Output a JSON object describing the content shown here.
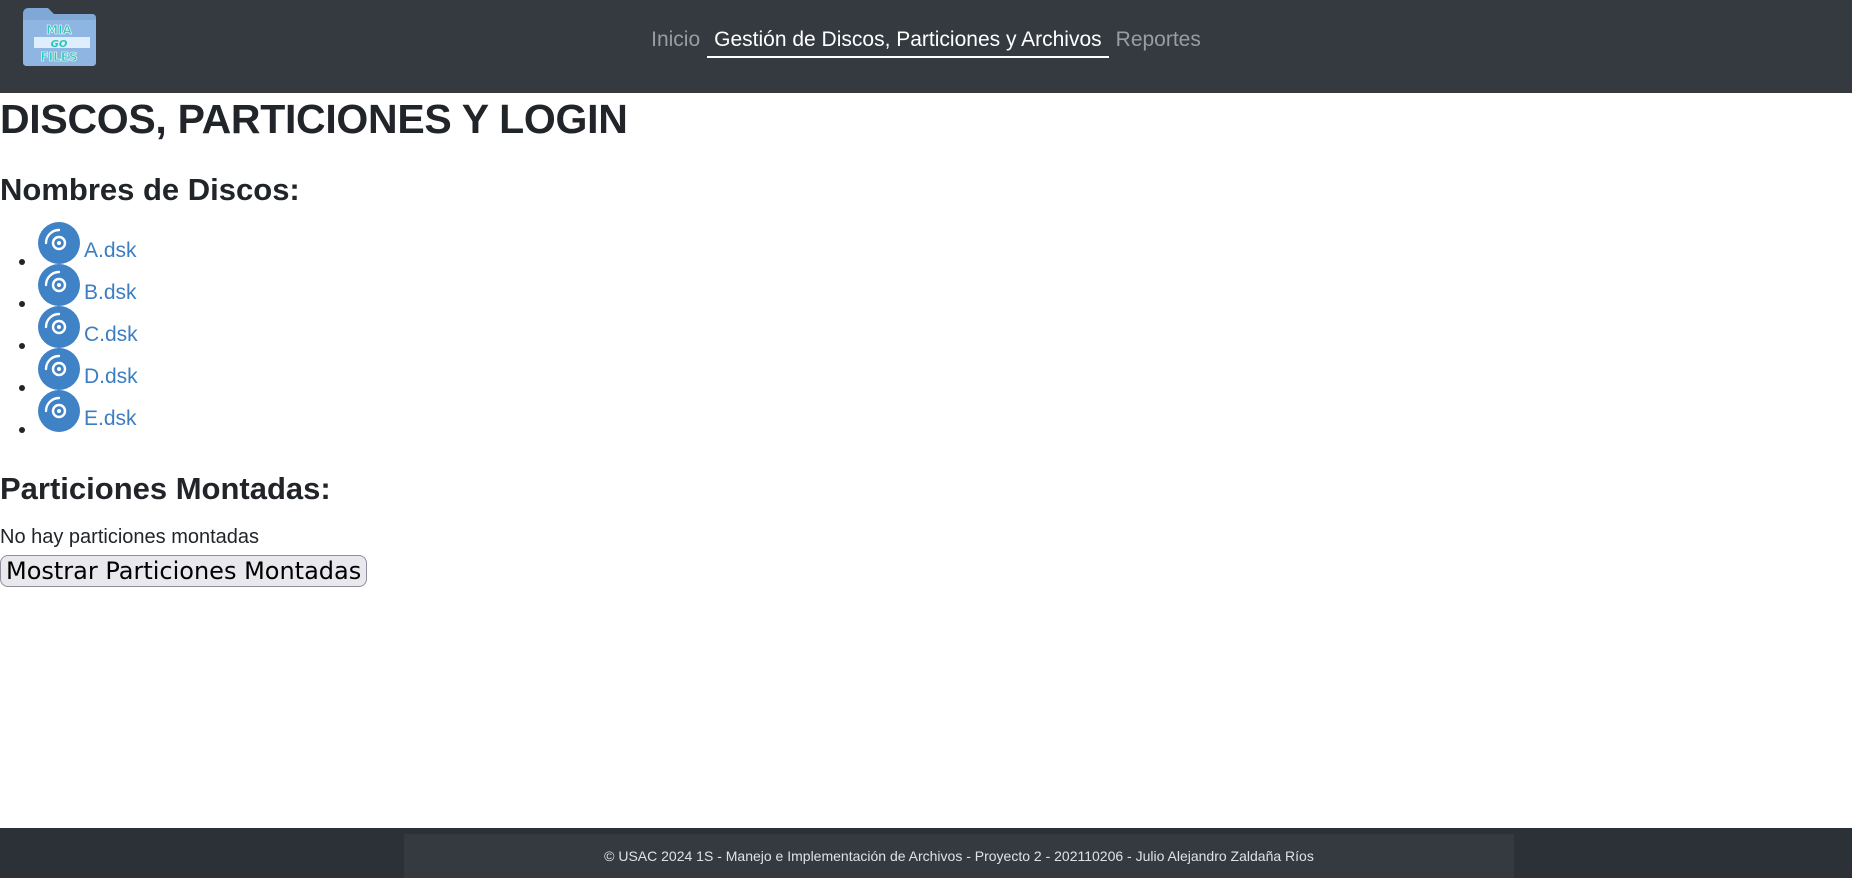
{
  "header": {
    "logo_text": "MIA GO FILES",
    "nav": [
      {
        "label": "Inicio"
      },
      {
        "label": "Gestión de Discos, Particiones y Archivos"
      },
      {
        "label": "Reportes"
      }
    ]
  },
  "main": {
    "title": "DISCOS, PARTICIONES Y LOGIN",
    "disks_heading": "Nombres de Discos:",
    "disks": [
      {
        "name": "A.dsk"
      },
      {
        "name": "B.dsk"
      },
      {
        "name": "C.dsk"
      },
      {
        "name": "D.dsk"
      },
      {
        "name": "E.dsk"
      }
    ],
    "partitions_heading": "Particiones Montadas:",
    "no_partitions_text": "No hay particiones montadas",
    "show_button_label": "Mostrar Particiones Montadas"
  },
  "footer": {
    "text": "© USAC 2024 1S - Manejo e Implementación de Archivos - Proyecto 2 - 202110206 - Julio Alejandro Zaldaña Ríos"
  },
  "colors": {
    "navbar": "#343a40",
    "link": "#3c7ec3",
    "disk_icon": "#3f82c6"
  }
}
